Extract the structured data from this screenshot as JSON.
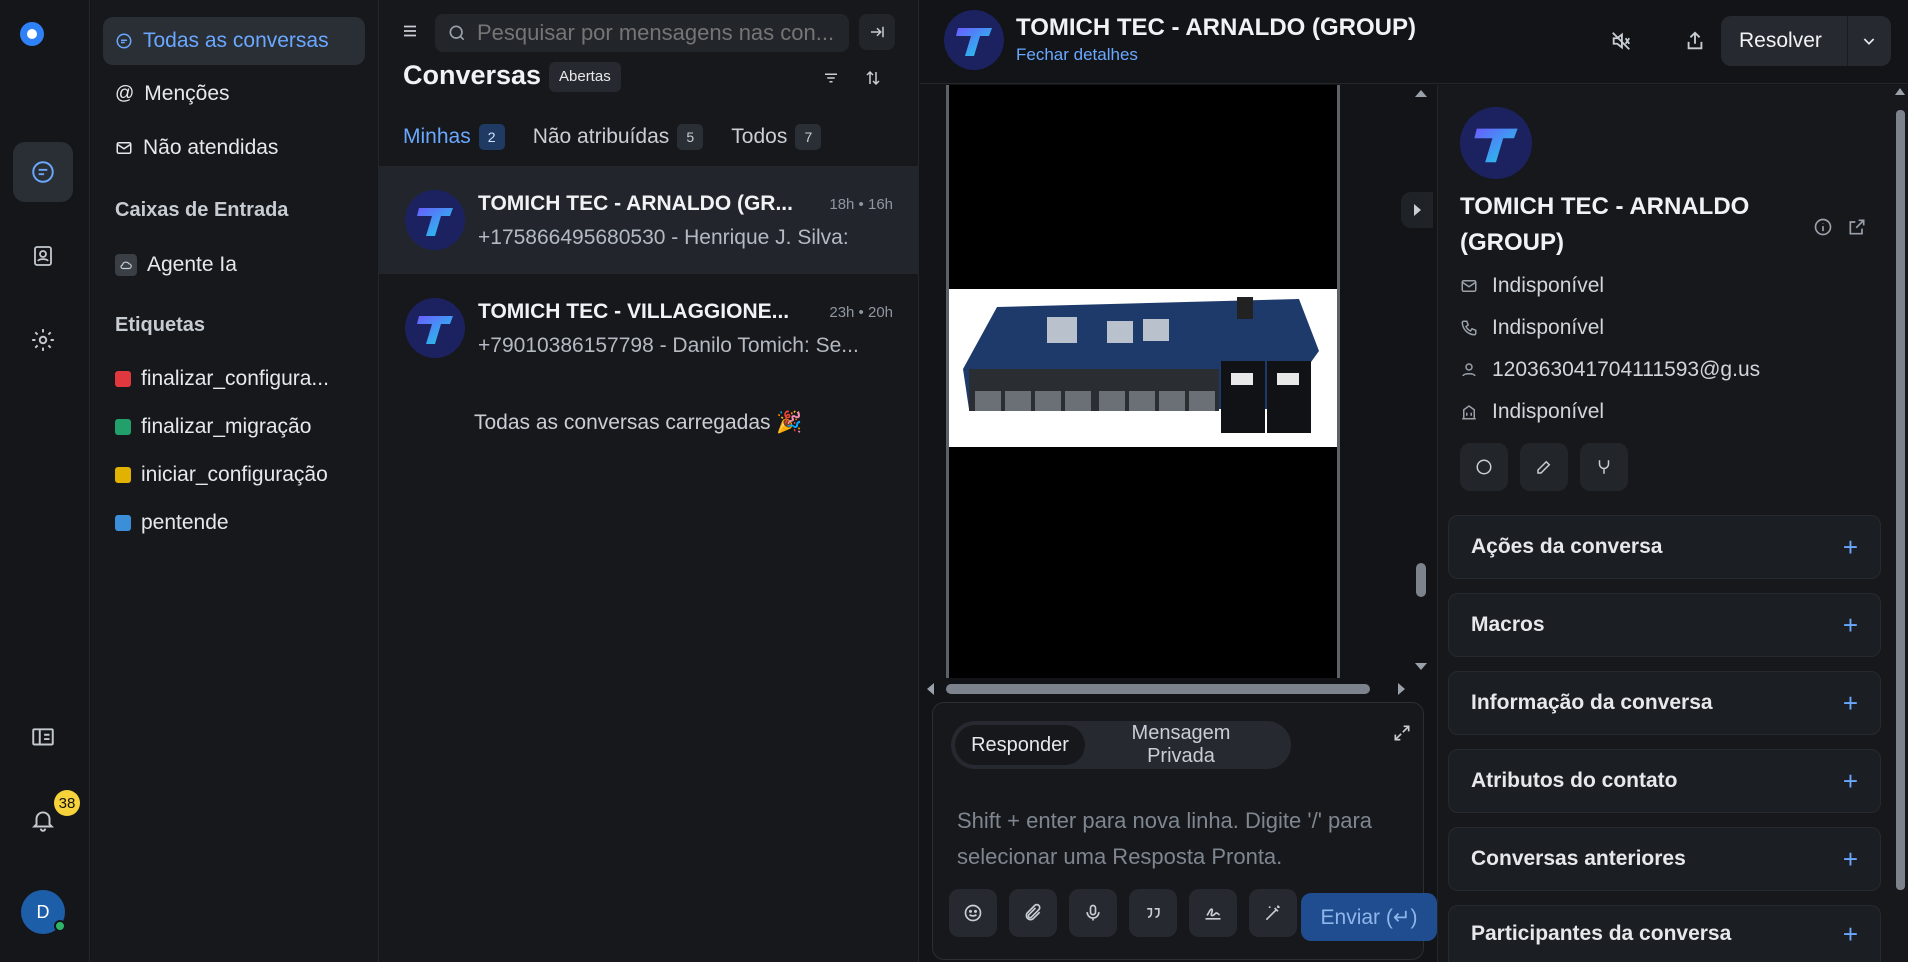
{
  "sidebar": {
    "items": [
      {
        "label": "Todas as conversas"
      },
      {
        "label": "Menções"
      },
      {
        "label": "Não atendidas"
      }
    ],
    "inboxes_title": "Caixas de Entrada",
    "inboxes": [
      {
        "label": "Agente Ia"
      }
    ],
    "labels_title": "Etiquetas",
    "labels": [
      {
        "label": "finalizar_configura...",
        "color": "#e0383e"
      },
      {
        "label": "finalizar_migração",
        "color": "#22a06b"
      },
      {
        "label": "iniciar_configuração",
        "color": "#e2b203"
      },
      {
        "label": "pentende",
        "color": "#3b8fd9"
      }
    ],
    "notifications_count": "38",
    "avatar_initial": "D"
  },
  "list": {
    "search_placeholder": "Pesquisar por mensagens nas con...",
    "title": "Conversas",
    "status": "Abertas",
    "tabs": [
      {
        "label": "Minhas",
        "count": "2"
      },
      {
        "label": "Não atribuídas",
        "count": "5"
      },
      {
        "label": "Todos",
        "count": "7"
      }
    ],
    "conversations": [
      {
        "name": "TOMICH TEC - ARNALDO (GR...",
        "time": "18h • 16h",
        "preview": "+175866495680530 - Henrique J. Silva:"
      },
      {
        "name": "TOMICH TEC - VILLAGGIONE...",
        "time": "23h • 20h",
        "preview": "+79010386157798 - Danilo Tomich: Se..."
      }
    ],
    "all_loaded": "Todas as conversas carregadas 🎉"
  },
  "header": {
    "title": "TOMICH TEC - ARNALDO (GROUP)",
    "subtitle": "Fechar detalhes",
    "resolve_label": "Resolver"
  },
  "composer": {
    "reply_label": "Responder",
    "private_label": "Mensagem Privada",
    "placeholder": "Shift + enter para nova linha. Digite '/' para selecionar uma Resposta Pronta.",
    "send_label": "Enviar (↵)"
  },
  "contact": {
    "name": "TOMICH TEC - ARNALDO (GROUP)",
    "email": "Indisponível",
    "phone": "Indisponível",
    "identifier": "120363041704111593@g.us",
    "company": "Indisponível",
    "sections": [
      {
        "label": "Ações da conversa"
      },
      {
        "label": "Macros"
      },
      {
        "label": "Informação da conversa"
      },
      {
        "label": "Atributos do contato"
      },
      {
        "label": "Conversas anteriores"
      },
      {
        "label": "Participantes da conversa"
      }
    ]
  },
  "colors": {
    "accent": "#6aa8ff",
    "background": "#121417",
    "panel": "#16181c",
    "badge": "#f6d33b"
  }
}
